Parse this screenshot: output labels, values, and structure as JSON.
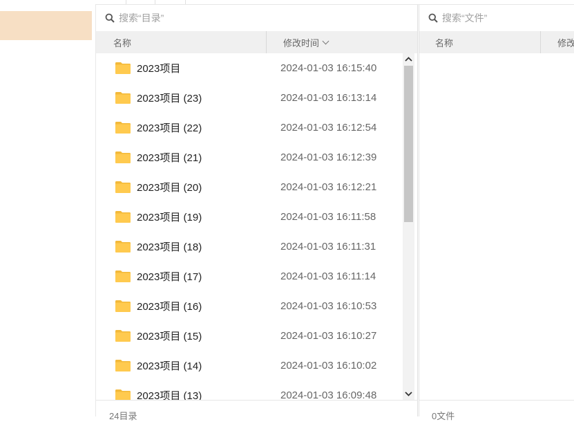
{
  "left_pane": {
    "search_placeholder": "搜索“目录”",
    "columns": {
      "name": "名称",
      "time": "修改时间"
    },
    "rows": [
      {
        "name": "2023项目",
        "time": "2024-01-03 16:15:40"
      },
      {
        "name": "2023项目 (23)",
        "time": "2024-01-03 16:13:14"
      },
      {
        "name": "2023项目 (22)",
        "time": "2024-01-03 16:12:54"
      },
      {
        "name": "2023项目 (21)",
        "time": "2024-01-03 16:12:39"
      },
      {
        "name": "2023项目 (20)",
        "time": "2024-01-03 16:12:21"
      },
      {
        "name": "2023项目 (19)",
        "time": "2024-01-03 16:11:58"
      },
      {
        "name": "2023项目 (18)",
        "time": "2024-01-03 16:11:31"
      },
      {
        "name": "2023项目 (17)",
        "time": "2024-01-03 16:11:14"
      },
      {
        "name": "2023项目 (16)",
        "time": "2024-01-03 16:10:53"
      },
      {
        "name": "2023项目 (15)",
        "time": "2024-01-03 16:10:27"
      },
      {
        "name": "2023项目 (14)",
        "time": "2024-01-03 16:10:02"
      },
      {
        "name": "2023项目 (13)",
        "time": "2024-01-03 16:09:48"
      }
    ],
    "footer": "24目录"
  },
  "right_pane": {
    "search_placeholder": "搜索“文件”",
    "columns": {
      "name": "名称",
      "time": "修改"
    },
    "footer": "0文件"
  },
  "colors": {
    "selected_nav": "#f7dfc4",
    "folder": "#ffc94a",
    "header_bg": "#f0f0f0"
  },
  "icons": {
    "search": "search-icon",
    "folder": "folder-icon",
    "sort": "chevron-down-icon",
    "scroll_up": "scroll-up-arrow-icon",
    "scroll_down": "scroll-down-arrow-icon"
  }
}
